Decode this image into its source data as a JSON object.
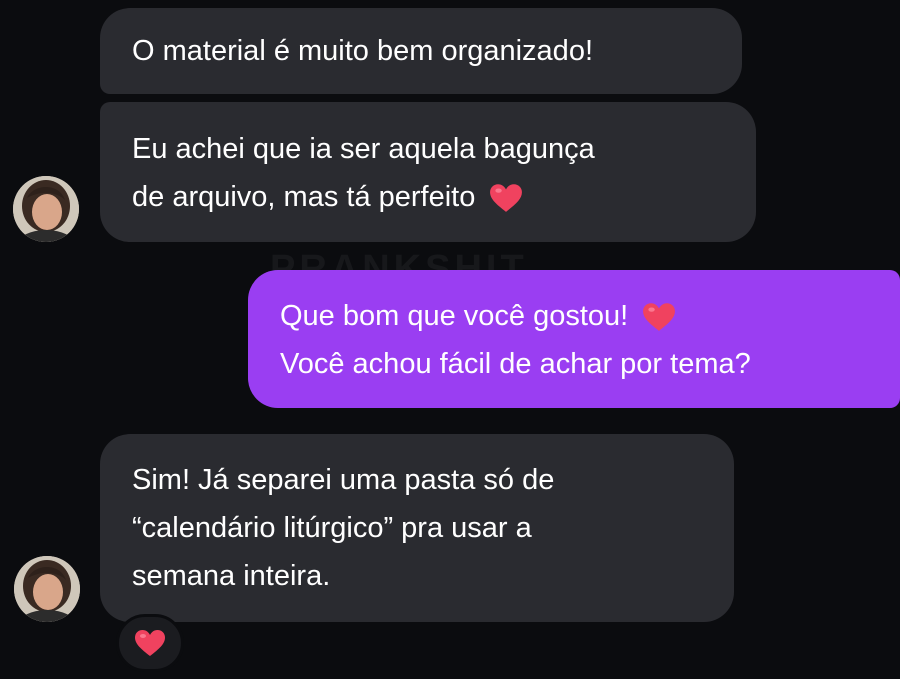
{
  "watermark": "PRANKSHIT",
  "messages": [
    {
      "direction": "incoming",
      "lines": [
        "O material é muito bem organizado!"
      ]
    },
    {
      "direction": "incoming",
      "lines": [
        "Eu achei que ia ser aquela bagunça",
        "de arquivo, mas tá perfeito"
      ],
      "emoji": "heart-icon"
    },
    {
      "direction": "outgoing",
      "lines": [
        "Que bom que você gostou!",
        "Você achou fácil de achar por tema?"
      ],
      "emoji": "heart-icon"
    },
    {
      "direction": "incoming",
      "lines": [
        "Sim! Já separei uma pasta só de",
        "“calendário litúrgico” pra usar a",
        "semana inteira."
      ],
      "reaction": "heart-icon"
    }
  ],
  "colors": {
    "background": "#0b0c0f",
    "incoming_bubble": "#2a2b30",
    "outgoing_bubble": "#9a3ef2",
    "heart": "#f0425f"
  }
}
